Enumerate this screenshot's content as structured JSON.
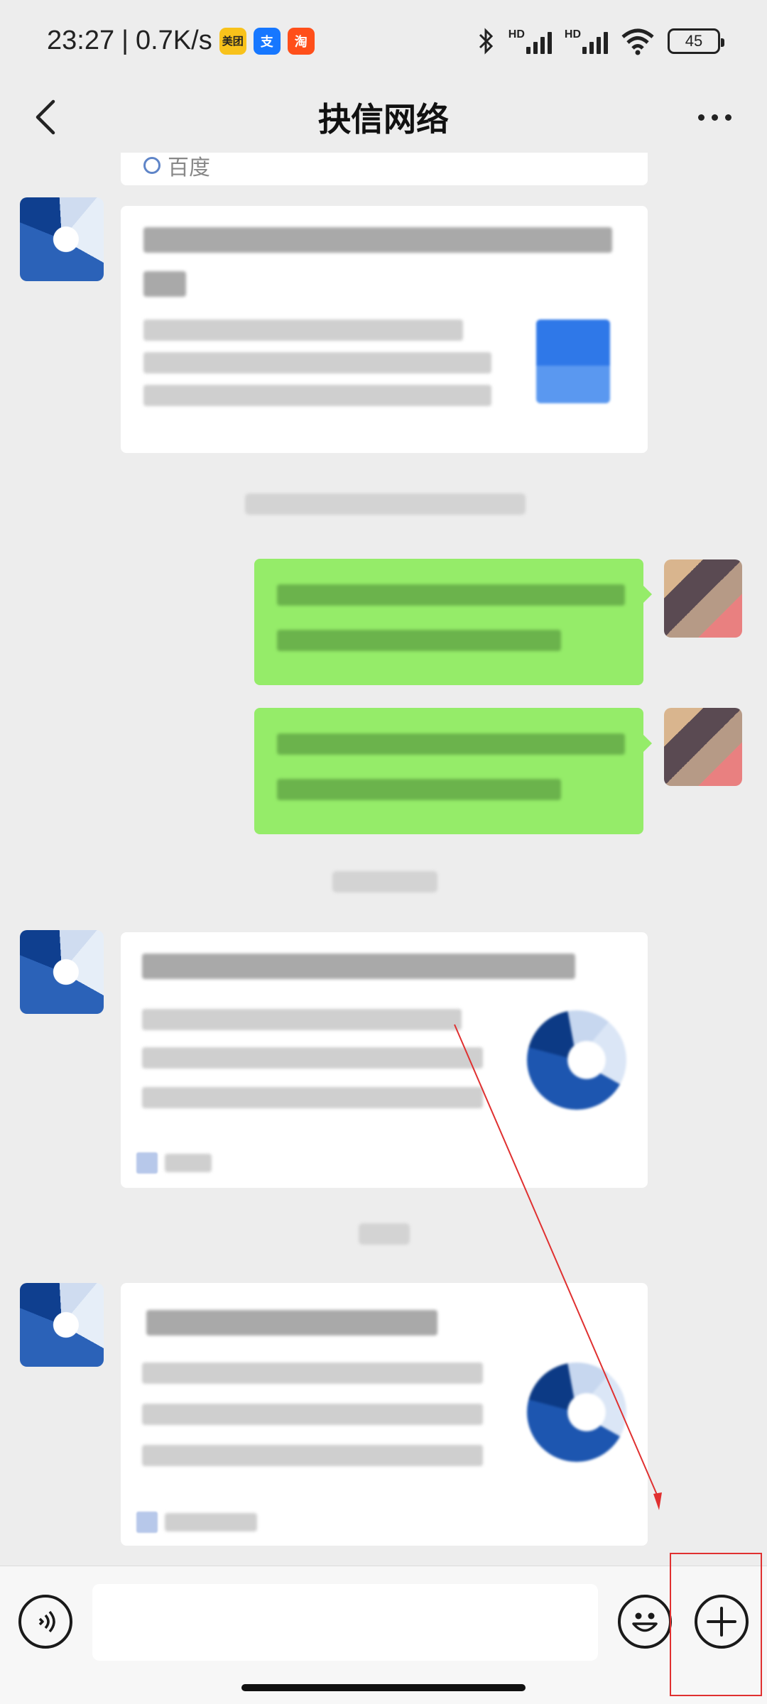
{
  "status_bar": {
    "time": "23:27",
    "separator": "|",
    "net_speed": "0.7K/s",
    "apps": [
      {
        "icon": "meituan-icon",
        "label": "美团",
        "color": "#f8c21b"
      },
      {
        "icon": "alipay-icon",
        "label": "支",
        "color": "#1677ff"
      },
      {
        "icon": "taobao-icon",
        "label": "淘",
        "color": "#ff4f1a"
      }
    ],
    "hd1": "HD",
    "hd2": "HD",
    "battery": "45"
  },
  "header": {
    "title": "抉信网络"
  },
  "chat": {
    "partial_card_source": "百度"
  },
  "input_bar": {
    "text_value": ""
  },
  "icons": [
    "back-icon",
    "more-icon",
    "voice-icon",
    "emoji-icon",
    "plus-icon",
    "bluetooth-icon",
    "wifi-icon"
  ],
  "colors": {
    "background": "#ededed",
    "sent_bubble": "#95ec69",
    "annotation": "#e03030"
  }
}
